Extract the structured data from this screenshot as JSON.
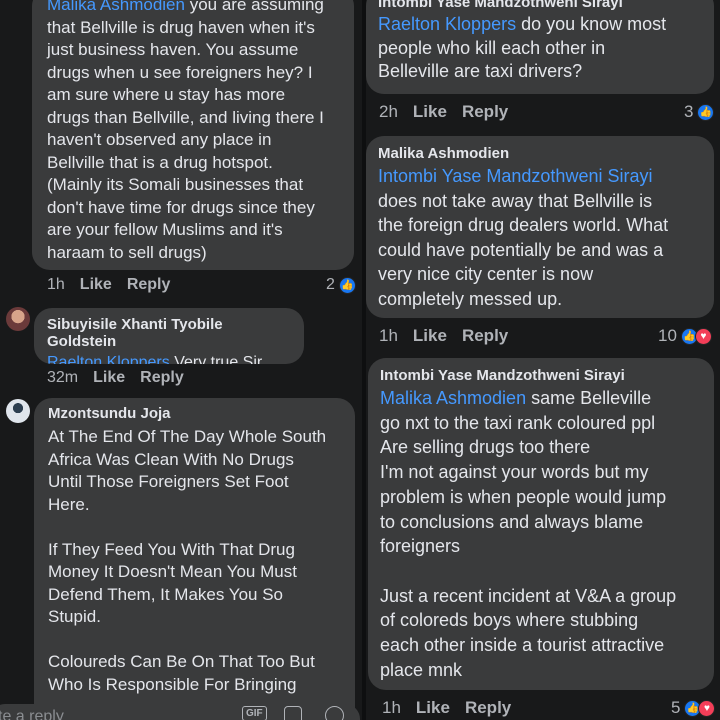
{
  "left": {
    "comment1": {
      "mention": "Malika Ashmodien",
      "text_first": " you are assuming",
      "text_rest": "that Bellville is drug haven when it's\njust business haven. You assume\ndrugs when u see foreigners hey? I\nam sure where u stay has more\ndrugs than Bellville, and living there I\nhaven't observed any place in\nBellville that is a drug hotspot.\n(Mainly its Somali businesses that\ndon't have time for drugs since they\nare your fellow Muslims and it's\nharaam to sell drugs)",
      "time": "1h",
      "like": "Like",
      "reply": "Reply",
      "reactions": "2"
    },
    "comment2": {
      "author": "Sibuyisile Xhanti Tyobile Goldstein",
      "mention": "Raelton Kloppers",
      "text": " Very true Sir",
      "time": "32m",
      "like": "Like",
      "reply": "Reply"
    },
    "comment3": {
      "author": "Mzontsundu Joja",
      "text": "At The End Of The Day Whole South\nAfrica Was Clean With No Drugs\nUntil Those Foreigners Set Foot\nHere.\n\nIf They Feed You With That Drug\nMoney It Doesn't Mean You Must\nDefend Them, It Makes You So\nStupid.\n\nColoureds Can Be On That Too But\nWho Is Responsible For Bringing"
    },
    "input": {
      "placeholder": "te a reply",
      "gif": "GIF"
    }
  },
  "right": {
    "comment1": {
      "author": "Intombi Yase Mandzothweni Sirayi",
      "mention": "Raelton Kloppers",
      "text_first": " do you know most",
      "text_rest": "people who kill each other in\nBelleville are taxi drivers?",
      "time": "2h",
      "like": "Like",
      "reply": "Reply",
      "reactions": "3"
    },
    "comment2": {
      "author": "Malika Ashmodien",
      "mention": "Intombi Yase Mandzothweni Sirayi",
      "text": "does not take away that Bellville is\nthe foreign drug dealers world. What\ncould have potentially be and was a\nvery nice city center is now\ncompletely messed up.",
      "time": "1h",
      "like": "Like",
      "reply": "Reply",
      "reactions": "10"
    },
    "comment3": {
      "author": "Intombi Yase Mandzothweni Sirayi",
      "mention": "Malika Ashmodien",
      "text_first": " same Belleville",
      "text_rest": "go nxt to the taxi rank coloured ppl\nAre selling drugs too there\nI'm not against your words but my\nproblem is when people would jump\nto conclusions and always blame\nforeigners\n\nJust a recent incident at V&A a group\nof coloreds boys where stubbing\neach other inside a tourist attractive\nplace mnk",
      "time": "1h",
      "like": "Like",
      "reply": "Reply",
      "reactions": "5"
    }
  },
  "icons": {
    "like": "thumbs-up-icon",
    "love": "heart-icon"
  },
  "colors": {
    "background": "#18191a",
    "bubble": "#3a3b3c",
    "text": "#e4e6eb",
    "mention": "#4599ff",
    "meta": "#b0b3b8",
    "like_blue": "#1877f2",
    "love_red": "#f33e58"
  }
}
